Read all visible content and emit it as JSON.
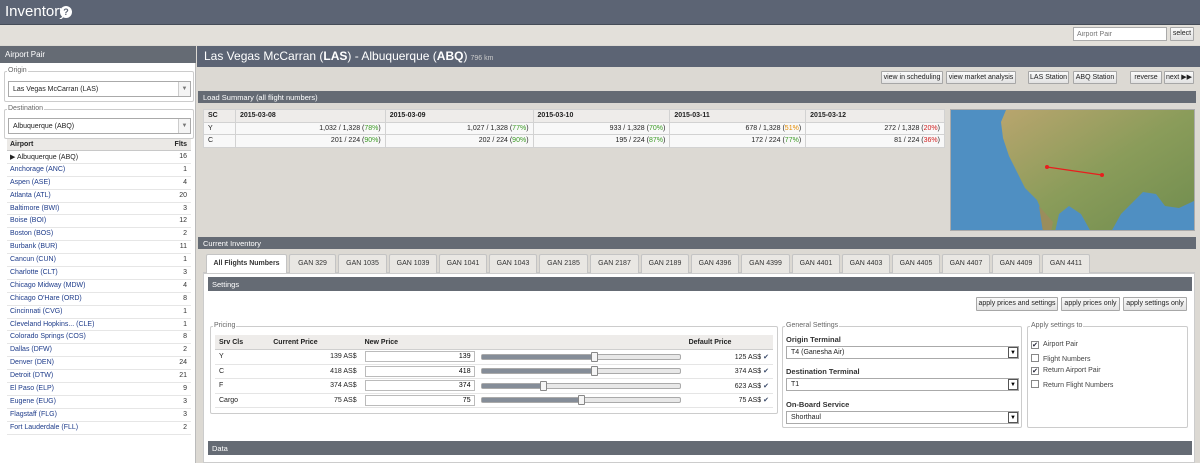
{
  "app": {
    "title": "Inventory",
    "help_icon": "?"
  },
  "toolbar": {
    "airport_pair_placeholder": "Airport Pair",
    "select_label": "select"
  },
  "sidebar": {
    "header": "Airport Pair",
    "origin_legend": "Origin",
    "origin_value": "Las Vegas McCarran (LAS)",
    "destination_legend": "Destination",
    "destination_value": "Albuquerque (ABQ)",
    "table_headers": [
      "Airport",
      "Flts"
    ],
    "airports": [
      {
        "name": "▶ Albuquerque (ABQ)",
        "flts": "16"
      },
      {
        "name": "Anchorage (ANC)",
        "flts": "1"
      },
      {
        "name": "Aspen (ASE)",
        "flts": "4"
      },
      {
        "name": "Atlanta (ATL)",
        "flts": "20"
      },
      {
        "name": "Baltimore (BWI)",
        "flts": "3"
      },
      {
        "name": "Boise (BOI)",
        "flts": "12"
      },
      {
        "name": "Boston (BOS)",
        "flts": "2"
      },
      {
        "name": "Burbank (BUR)",
        "flts": "11"
      },
      {
        "name": "Cancun (CUN)",
        "flts": "1"
      },
      {
        "name": "Charlotte (CLT)",
        "flts": "3"
      },
      {
        "name": "Chicago Midway (MDW)",
        "flts": "4"
      },
      {
        "name": "Chicago O'Hare (ORD)",
        "flts": "8"
      },
      {
        "name": "Cincinnati (CVG)",
        "flts": "1"
      },
      {
        "name": "Cleveland Hopkins... (CLE)",
        "flts": "1"
      },
      {
        "name": "Colorado Springs (COS)",
        "flts": "8"
      },
      {
        "name": "Dallas (DFW)",
        "flts": "2"
      },
      {
        "name": "Denver (DEN)",
        "flts": "24"
      },
      {
        "name": "Detroit (DTW)",
        "flts": "21"
      },
      {
        "name": "El Paso (ELP)",
        "flts": "9"
      },
      {
        "name": "Eugene (EUG)",
        "flts": "3"
      },
      {
        "name": "Flagstaff (FLG)",
        "flts": "3"
      },
      {
        "name": "Fort Lauderdale (FLL)",
        "flts": "2"
      }
    ]
  },
  "main": {
    "title_prefix": "Las Vegas McCarran (",
    "title_origin_code": "LAS",
    "title_middle": ") - Albuquerque (",
    "title_dest_code": "ABQ",
    "title_suffix": ")",
    "distance": "796 km",
    "buttons": {
      "view_scheduling": "view in scheduling",
      "view_market": "view market analysis",
      "las_station": "LAS Station",
      "abq_station": "ABQ Station",
      "reverse": "reverse",
      "next": "next ▶▶"
    }
  },
  "load_summary": {
    "header": "Load Summary (all flight numbers)",
    "columns": [
      "SC",
      "2015-03-08",
      "2015-03-09",
      "2015-03-10",
      "2015-03-11",
      "2015-03-12"
    ],
    "rows": [
      {
        "sc": "Y",
        "cells": [
          {
            "base": "1,032 / 1,328 (",
            "pct": "78%",
            "color": "g"
          },
          {
            "base": "1,027 / 1,328 (",
            "pct": "77%",
            "color": "g"
          },
          {
            "base": "933 / 1,328 (",
            "pct": "70%",
            "color": "g"
          },
          {
            "base": "678 / 1,328 (",
            "pct": "51%",
            "color": "o"
          },
          {
            "base": "272 / 1,328 (",
            "pct": "20%",
            "color": "rd"
          }
        ]
      },
      {
        "sc": "C",
        "cells": [
          {
            "base": "201 / 224 (",
            "pct": "90%",
            "color": "g"
          },
          {
            "base": "202 / 224 (",
            "pct": "90%",
            "color": "g"
          },
          {
            "base": "195 / 224 (",
            "pct": "87%",
            "color": "g"
          },
          {
            "base": "172 / 224 (",
            "pct": "77%",
            "color": "g"
          },
          {
            "base": "81 / 224 (",
            "pct": "36%",
            "color": "rd"
          }
        ]
      }
    ]
  },
  "current_inventory": {
    "header": "Current Inventory",
    "tabs": [
      "All Flights Numbers",
      "GAN 329",
      "GAN 1035",
      "GAN 1039",
      "GAN 1041",
      "GAN 1043",
      "GAN 2185",
      "GAN 2187",
      "GAN 2189",
      "GAN 4396",
      "GAN 4399",
      "GAN 4401",
      "GAN 4403",
      "GAN 4405",
      "GAN 4407",
      "GAN 4409",
      "GAN 4411"
    ]
  },
  "settings": {
    "header": "Settings",
    "apply_prices_and_settings": "apply prices and settings",
    "apply_prices_only": "apply prices only",
    "apply_settings_only": "apply settings only",
    "pricing_legend": "Pricing",
    "pricing_headers": [
      "Srv Cls",
      "Current Price",
      "New Price",
      "Default Price"
    ],
    "pricing_rows": [
      {
        "cls": "Y",
        "current": "139 AS$",
        "new": "139",
        "default": "125 AS$",
        "level": 0.57
      },
      {
        "cls": "C",
        "current": "418 AS$",
        "new": "418",
        "default": "374 AS$",
        "level": 0.57
      },
      {
        "cls": "F",
        "current": "374 AS$",
        "new": "374",
        "default": "623 AS$",
        "level": 0.31
      },
      {
        "cls": "Cargo",
        "current": "75 AS$",
        "new": "75",
        "default": "75 AS$",
        "level": 0.5
      }
    ],
    "general_legend": "General Settings",
    "origin_terminal_label": "Origin Terminal",
    "origin_terminal_value": "T4 (Ganesha Air)",
    "destination_terminal_label": "Destination Terminal",
    "destination_terminal_value": "T1",
    "onboard_service_label": "On-Board Service",
    "onboard_service_value": "Shorthaul",
    "apply_to_legend": "Apply settings to",
    "apply_to_options": [
      {
        "label": "Airport Pair",
        "checked": true
      },
      {
        "label": "Flight Numbers",
        "checked": false
      },
      {
        "label": "Return Airport Pair",
        "checked": true
      },
      {
        "label": "Return Flight Numbers",
        "checked": false
      }
    ]
  },
  "data_section": {
    "header": "Data"
  },
  "colors": {
    "header_bg": "#5c6474",
    "band_bg": "#656b74",
    "good": "#3c9b26",
    "warn": "#e48b00",
    "bad": "#d02020"
  }
}
